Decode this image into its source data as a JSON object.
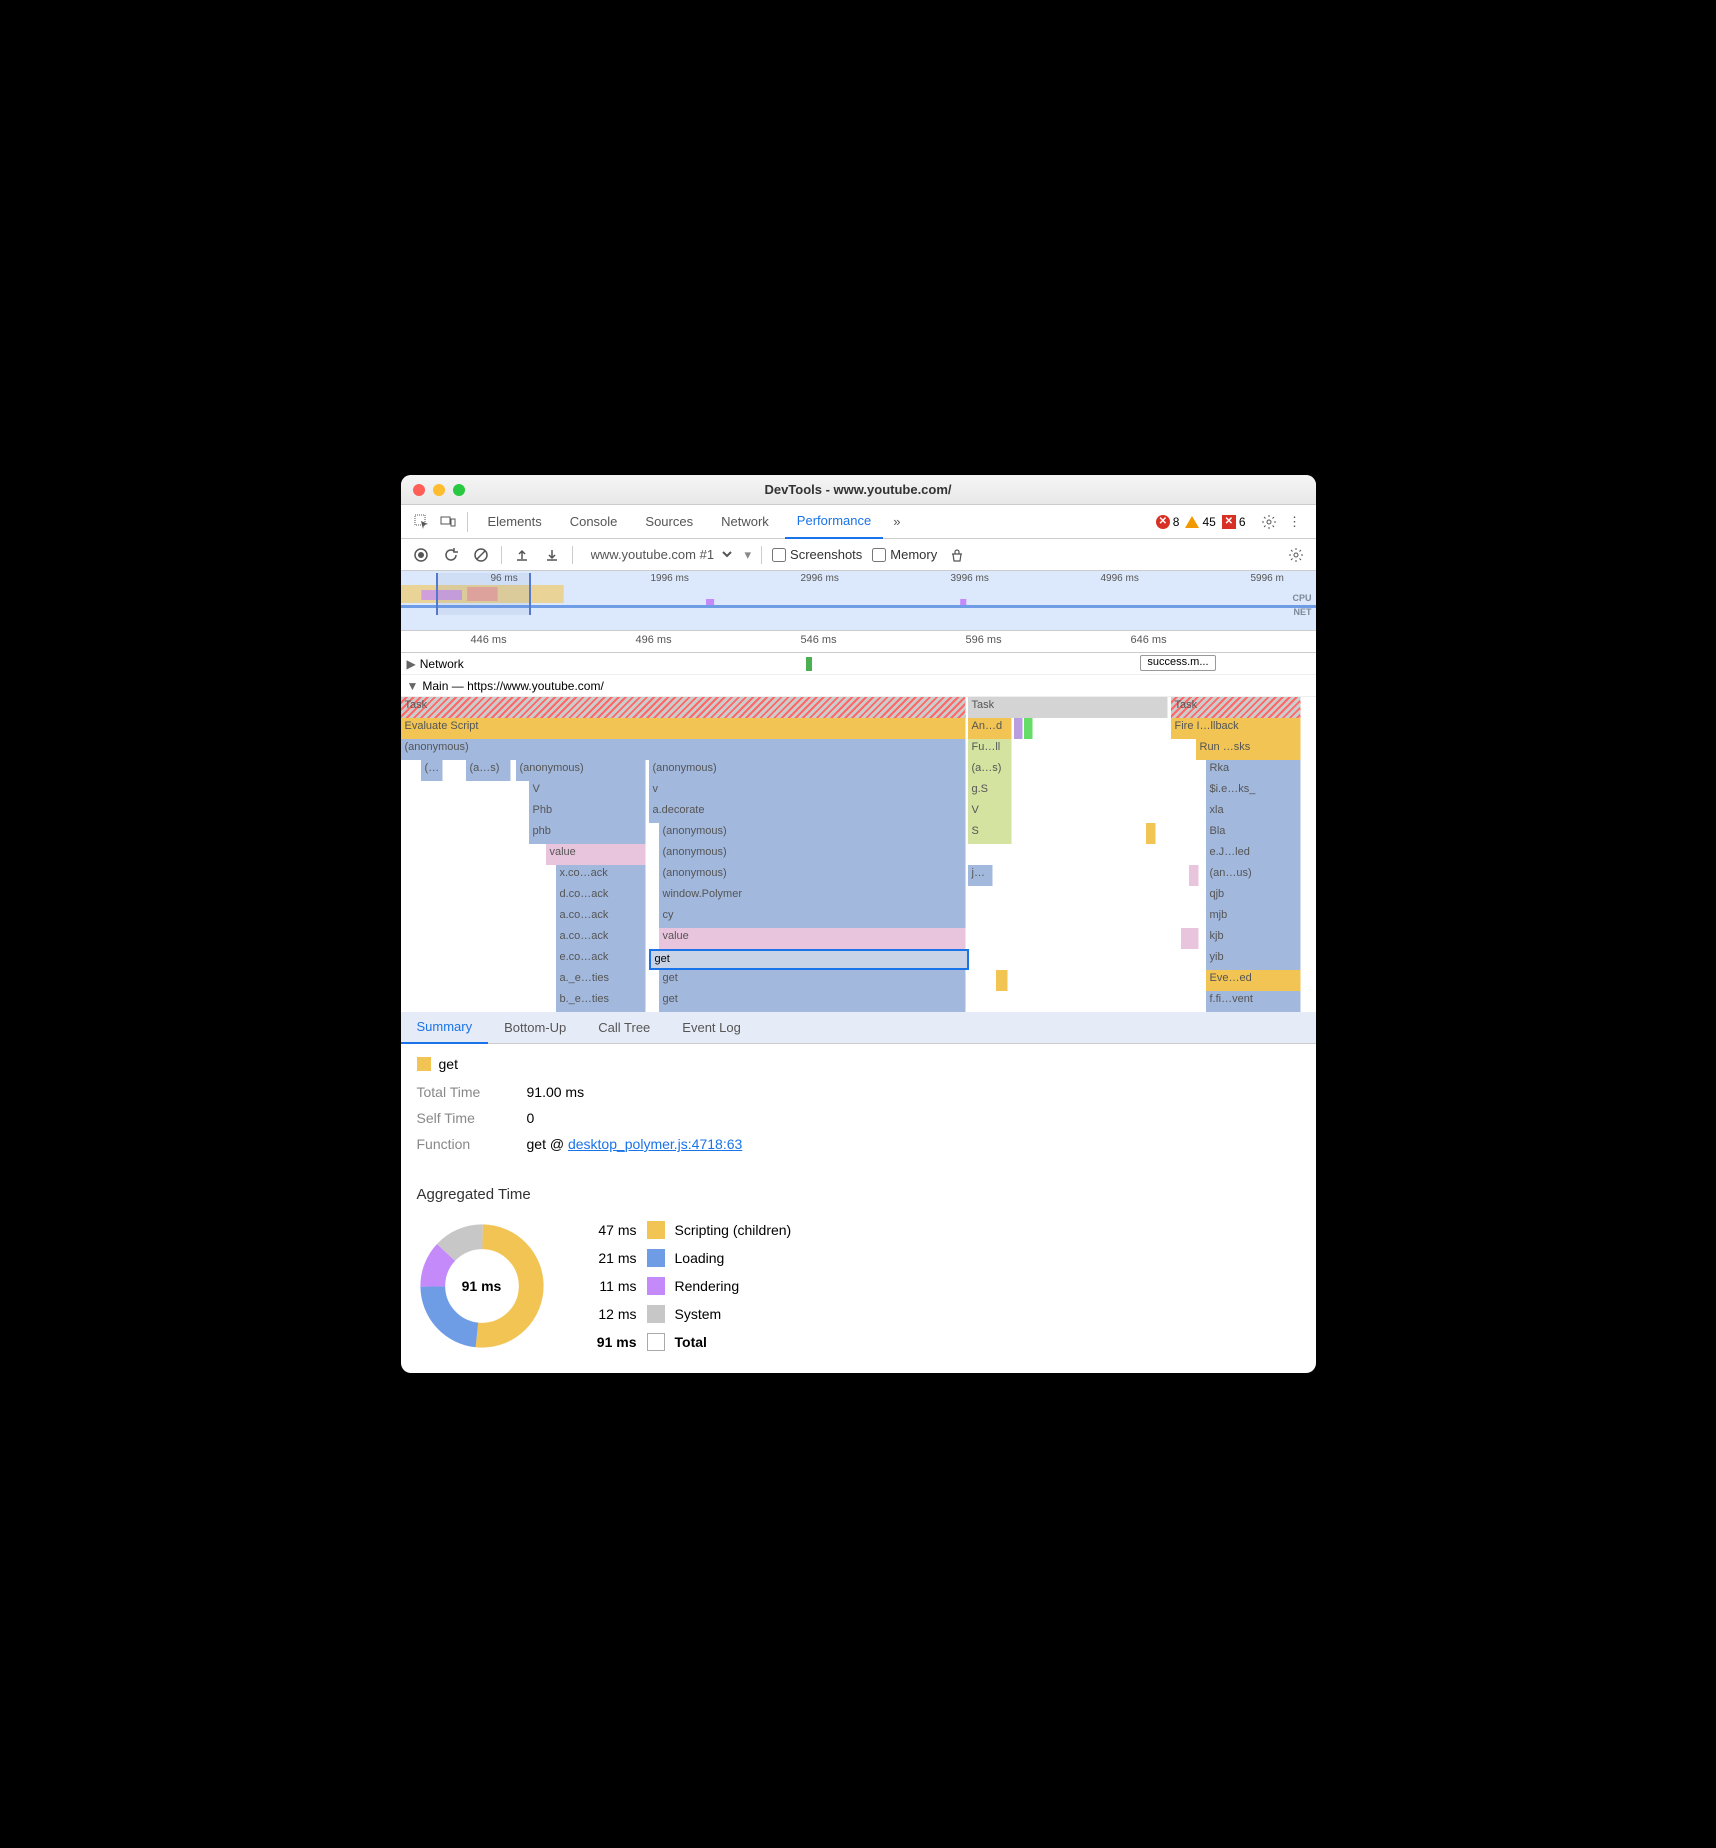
{
  "window": {
    "title": "DevTools - www.youtube.com/"
  },
  "mainTabs": [
    "Elements",
    "Console",
    "Sources",
    "Network",
    "Performance"
  ],
  "activeMainTab": "Performance",
  "statusCounts": {
    "errors": 8,
    "warnings": 45,
    "xerrors": 6
  },
  "toolbar": {
    "target": "www.youtube.com #1",
    "screenshots_label": "Screenshots",
    "memory_label": "Memory"
  },
  "overview": {
    "ticks": [
      "96 ms",
      "1996 ms",
      "2996 ms",
      "3996 ms",
      "4996 ms",
      "5996 m"
    ],
    "labels": [
      "CPU",
      "NET"
    ]
  },
  "ruler": [
    "446 ms",
    "496 ms",
    "546 ms",
    "596 ms",
    "646 ms"
  ],
  "network": {
    "label": "Network",
    "pill": "success.m..."
  },
  "main": {
    "label": "Main — https://www.youtube.com/"
  },
  "flame": {
    "col1": {
      "task": "Task",
      "eval": "Evaluate Script",
      "anon": "(anonymous)",
      "row4": [
        "(…",
        "(a…s)",
        "(anonymous)",
        "(anonymous)"
      ],
      "row5": [
        "V",
        "v"
      ],
      "row6": [
        "Phb",
        "a.decorate"
      ],
      "row7": [
        "phb",
        "(anonymous)"
      ],
      "row8": [
        "value",
        "(anonymous)"
      ],
      "row9": [
        "x.co…ack",
        "(anonymous)"
      ],
      "row10": [
        "d.co…ack",
        "window.Polymer"
      ],
      "row11": [
        "a.co…ack",
        "cy"
      ],
      "row12": [
        "a.co…ack",
        "value"
      ],
      "row13": [
        "e.co…ack",
        "get"
      ],
      "row14": [
        "a._e…ties",
        "get"
      ],
      "row15": [
        "b._e…ties",
        "get"
      ]
    },
    "col2": {
      "task": "Task",
      "an": "An…d",
      "fu": "Fu…ll",
      "as": "(a…s)",
      "gs": "g.S",
      "v": "V",
      "s": "S",
      "j": "j…"
    },
    "col3": {
      "task": "Task",
      "fire": "Fire I…llback",
      "run": "Run …sks",
      "rows": [
        "Rka",
        "$i.e…ks_",
        "xla",
        "Bla",
        "e.J…led",
        "(an…us)",
        "qjb",
        "mjb",
        "kjb",
        "yib",
        "Eve…ed",
        "f.fi…vent"
      ]
    }
  },
  "subTabs": [
    "Summary",
    "Bottom-Up",
    "Call Tree",
    "Event Log"
  ],
  "activeSubTab": "Summary",
  "summary": {
    "name": "get",
    "totalTimeLabel": "Total Time",
    "totalTime": "91.00 ms",
    "selfTimeLabel": "Self Time",
    "selfTime": "0",
    "functionLabel": "Function",
    "functionText": "get @ ",
    "functionLink": "desktop_polymer.js:4718:63"
  },
  "aggregated": {
    "title": "Aggregated Time",
    "center": "91 ms",
    "legend": [
      {
        "time": "47 ms",
        "color": "#f1c453",
        "label": "Scripting (children)"
      },
      {
        "time": "21 ms",
        "color": "#6e9de6",
        "label": "Loading"
      },
      {
        "time": "11 ms",
        "color": "#c58af9",
        "label": "Rendering"
      },
      {
        "time": "12 ms",
        "color": "#c7c7c7",
        "label": "System"
      }
    ],
    "total": {
      "time": "91 ms",
      "label": "Total"
    }
  },
  "chart_data": {
    "type": "pie",
    "title": "Aggregated Time",
    "categories": [
      "Scripting (children)",
      "Loading",
      "Rendering",
      "System"
    ],
    "values": [
      47,
      21,
      11,
      12
    ],
    "total": 91,
    "unit": "ms"
  }
}
